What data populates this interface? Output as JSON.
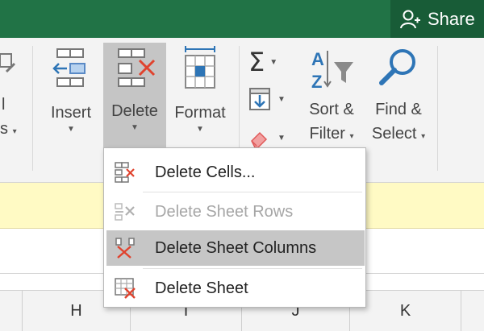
{
  "share": {
    "label": "Share"
  },
  "ribbon": {
    "left_partial_top": "l",
    "left_partial_bottom": "s",
    "insert_label": "Insert",
    "delete_label": "Delete",
    "format_label": "Format",
    "sort_label_1": "Sort &",
    "sort_label_2": "Filter",
    "find_label_1": "Find &",
    "find_label_2": "Select"
  },
  "menu": {
    "items": [
      {
        "label": "Delete Cells...",
        "enabled": true
      },
      {
        "label": "Delete Sheet Rows",
        "enabled": false
      },
      {
        "label": "Delete Sheet Columns",
        "enabled": true,
        "highlighted": true
      },
      {
        "label": "Delete Sheet",
        "enabled": true
      }
    ]
  },
  "columns": [
    "H",
    "I",
    "J",
    "K"
  ],
  "colors": {
    "title_green": "#217346",
    "delete_red": "#e0432e",
    "accent_blue": "#2e75b6"
  }
}
